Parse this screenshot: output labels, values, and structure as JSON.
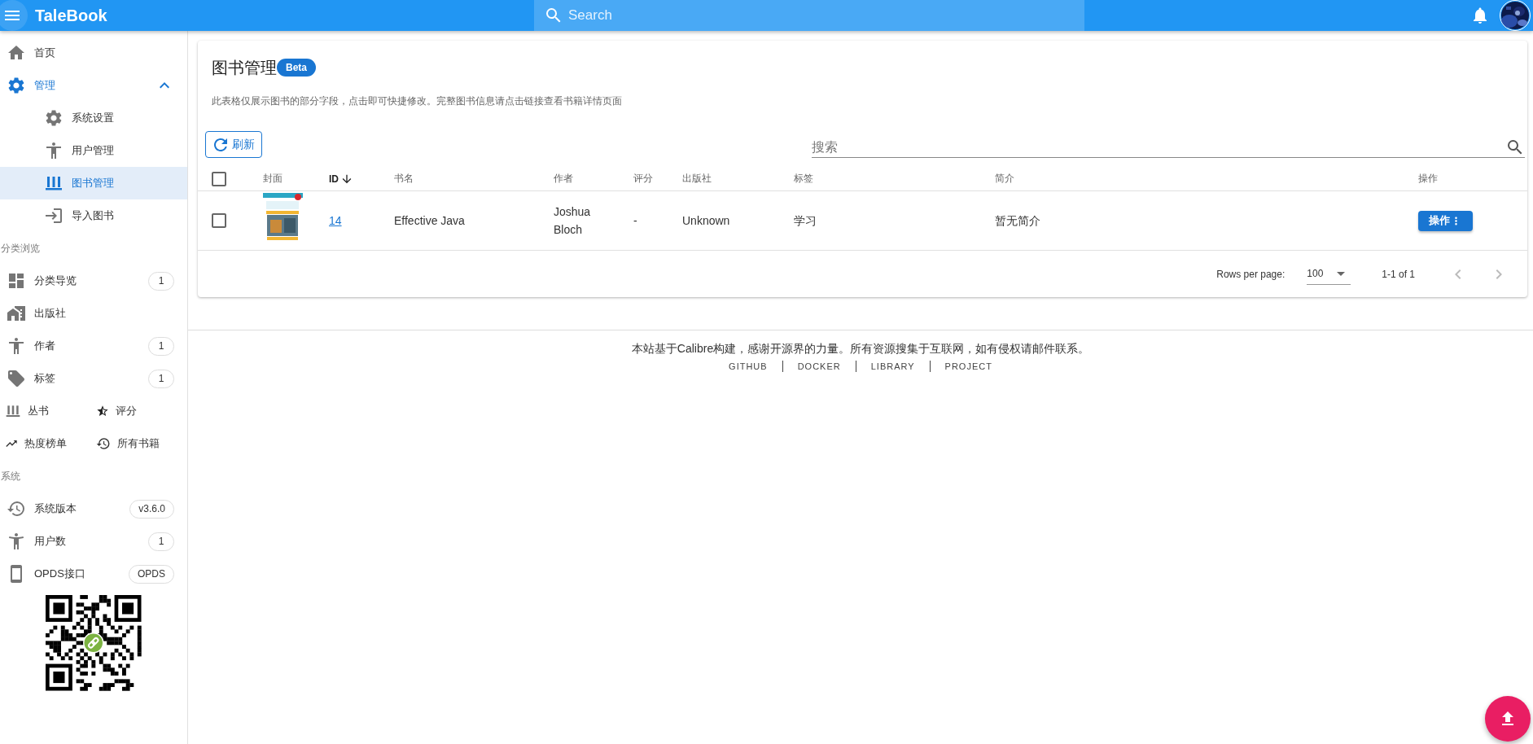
{
  "app_bar": {
    "title": "TaleBook",
    "search": {
      "placeholder": "Search"
    }
  },
  "sidebar": {
    "nav": [
      {
        "label": "首页",
        "selected": false
      },
      {
        "label": "管理",
        "expanded": true,
        "children": [
          {
            "label": "系统设置",
            "selected": false
          },
          {
            "label": "用户管理",
            "selected": false
          },
          {
            "label": "图书管理",
            "selected": true
          },
          {
            "label": "导入图书",
            "selected": false
          }
        ]
      }
    ],
    "sections": [
      {
        "title": "分类浏览",
        "rows": [
          {
            "label": "分类导览",
            "count": "1"
          },
          {
            "label": "出版社"
          },
          {
            "label": "作者",
            "count": "1"
          },
          {
            "label": "标签",
            "count": "1"
          }
        ],
        "grid": [
          {
            "label": "丛书"
          },
          {
            "label": "评分"
          },
          {
            "label": "热度榜单"
          },
          {
            "label": "所有书籍"
          }
        ]
      },
      {
        "title": "系统",
        "rows": [
          {
            "label": "系统版本",
            "count": "v3.6.0"
          },
          {
            "label": "用户数",
            "count": "1"
          },
          {
            "label": "OPDS接口",
            "count": "OPDS"
          }
        ]
      }
    ]
  },
  "page": {
    "title": "图书管理",
    "badge": "Beta",
    "description": "此表格仅展示图书的部分字段，点击即可快捷修改。完整图书信息请点击链接查看书籍详情页面",
    "refresh_button": "刷新",
    "search": {
      "placeholder": "搜索"
    },
    "table": {
      "select_all": {
        "checked": false
      },
      "columns": [
        {
          "label": "封面"
        },
        {
          "label": "ID",
          "sorted": true
        },
        {
          "label": "书名"
        },
        {
          "label": "作者"
        },
        {
          "label": "评分"
        },
        {
          "label": "出版社"
        },
        {
          "label": "标签"
        },
        {
          "label": "简介"
        },
        {
          "label": "操作"
        }
      ],
      "rows": [
        {
          "checked": false,
          "id": "14",
          "title": "Effective Java",
          "author": "Joshua Bloch",
          "rating": "-",
          "publisher": "Unknown",
          "tags": "学习",
          "summary": "暂无简介",
          "action": "操作"
        }
      ]
    },
    "pagination": {
      "rows_per_page_label": "Rows per page:",
      "rows_per_page": "100",
      "range": "1-1 of 1"
    }
  },
  "footer": {
    "text": "本站基于Calibre构建，感谢开源界的力量。所有资源搜集于互联网，如有侵权请邮件联系。",
    "links": [
      "GITHUB",
      "DOCKER",
      "LIBRARY",
      "PROJECT"
    ]
  }
}
